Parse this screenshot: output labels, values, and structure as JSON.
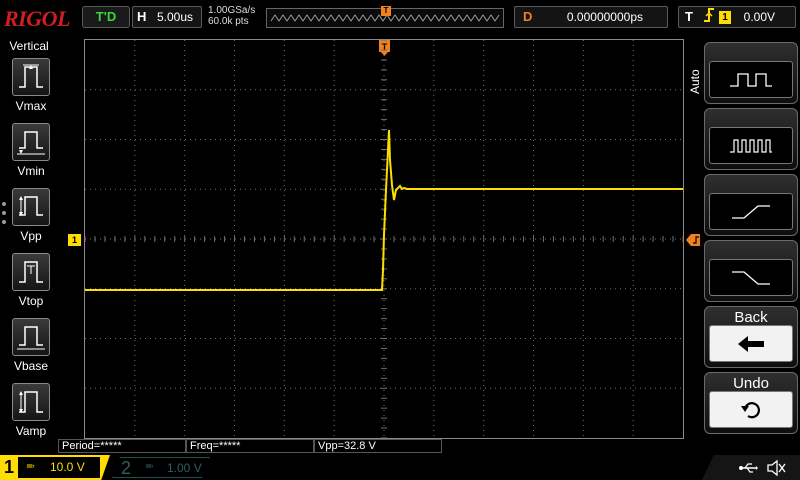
{
  "top_bar": {
    "brand": "RIGOL",
    "run_status": "T'D",
    "horizontal": {
      "label": "H",
      "timebase": "5.00us"
    },
    "sample_rate": "1.00GSa/s",
    "memory_depth": "60.0k pts",
    "trigger_position_label": "T",
    "delay": {
      "label": "D",
      "value": "0.00000000ps"
    },
    "trigger": {
      "label": "T",
      "source": "1",
      "level": "0.00V",
      "edge_icon": "rising-edge-icon"
    }
  },
  "left_panel": {
    "title": "Vertical",
    "items": [
      {
        "label": "Vmax",
        "icon": "vmax-icon"
      },
      {
        "label": "Vmin",
        "icon": "vmin-icon"
      },
      {
        "label": "Vpp",
        "icon": "vpp-icon"
      },
      {
        "label": "Vtop",
        "icon": "vtop-icon"
      },
      {
        "label": "Vbase",
        "icon": "vbase-icon"
      },
      {
        "label": "Vamp",
        "icon": "vamp-icon"
      }
    ]
  },
  "right_menu": {
    "mode_label": "Auto",
    "buttons": [
      {
        "label": "",
        "icon": "single-pulse-icon"
      },
      {
        "label": "",
        "icon": "multi-pulse-icon"
      },
      {
        "label": "",
        "icon": "rising-edge-icon"
      },
      {
        "label": "",
        "icon": "falling-edge-icon"
      },
      {
        "label": "Back",
        "icon": "back-arrow-icon"
      },
      {
        "label": "Undo",
        "icon": "undo-icon"
      }
    ]
  },
  "waveform": {
    "channel_marker": "1",
    "trigger_marker": "T",
    "color": "#ffdd00"
  },
  "measurements": {
    "period": "Period=*****",
    "freq": "Freq=*****",
    "vpp": "Vpp=32.8 V"
  },
  "bottom_bar": {
    "ch1": {
      "number": "1",
      "coupling": "≕",
      "scale": "10.0 V",
      "color": "#ffdd00"
    },
    "ch2": {
      "number": "2",
      "coupling": "≕",
      "scale": "1.00 V"
    },
    "status_icons": [
      "usb-icon",
      "speaker-muted-icon"
    ]
  }
}
